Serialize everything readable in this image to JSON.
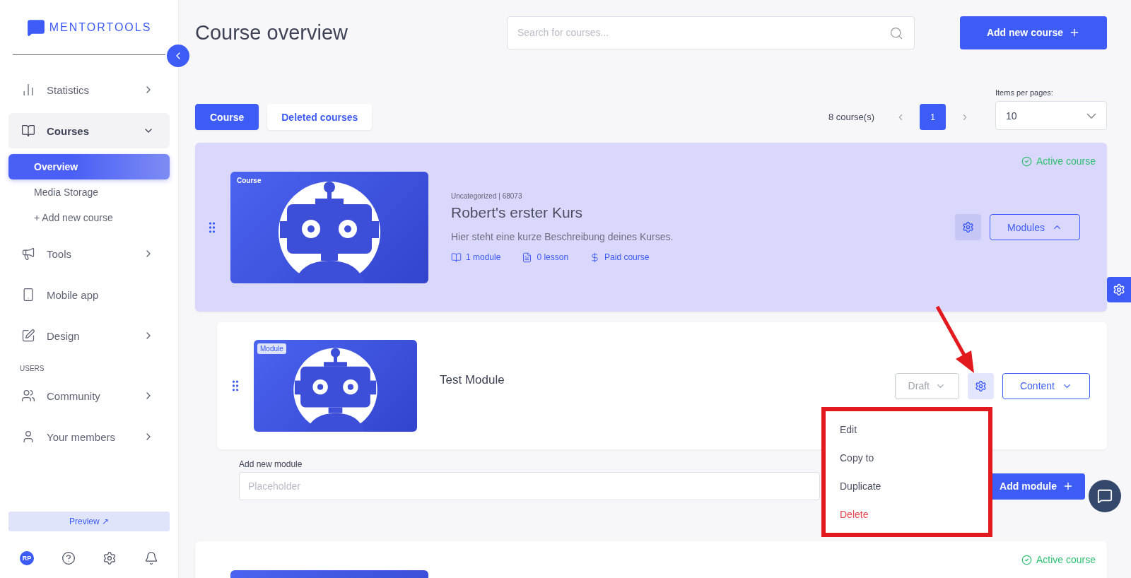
{
  "sidebar": {
    "logo": "MENTORTOOLS",
    "items": [
      {
        "kind": "item",
        "label": "Statistics",
        "expanded": false,
        "selected": false
      },
      {
        "kind": "item",
        "label": "Courses",
        "expanded": true,
        "selected": true,
        "children": [
          {
            "label": "Overview",
            "selected": true
          },
          {
            "label": "Media Storage",
            "selected": false
          },
          {
            "label": "+ Add new course",
            "selected": false
          }
        ]
      },
      {
        "kind": "item",
        "label": "Tools",
        "expanded": false,
        "selected": false
      },
      {
        "kind": "link",
        "label": "Mobile app",
        "selected": false
      },
      {
        "kind": "item",
        "label": "Design",
        "expanded": false,
        "selected": false
      },
      {
        "kind": "section",
        "label": "USERS"
      },
      {
        "kind": "item",
        "label": "Community",
        "expanded": false,
        "selected": false
      },
      {
        "kind": "item",
        "label": "Your members",
        "expanded": false,
        "selected": false
      }
    ],
    "preview": "Preview ↗",
    "avatar": "RP"
  },
  "header": {
    "title": "Course overview",
    "search": {
      "placeholder": "Search for courses..."
    },
    "add_button": "Add new course"
  },
  "tabs": [
    {
      "label": "Course",
      "selected": true
    },
    {
      "label": "Deleted courses",
      "selected": false
    }
  ],
  "pagination": {
    "count": "8 course(s)",
    "pages": [
      {
        "label": "1",
        "selected": true
      }
    ],
    "per_page_label": "Items per pages:",
    "per_page": "10"
  },
  "courses": [
    {
      "badge": "Course",
      "status": "Active course",
      "meta": "Uncategorized | 68073",
      "title": "Robert's erster Kurs",
      "description": "Hier steht eine kurze Beschreibung deines Kurses.",
      "stats": [
        {
          "text": "1 module"
        },
        {
          "text": "0 lesson"
        },
        {
          "text": "Paid course"
        }
      ],
      "modules_button": "Modules",
      "expanded": true,
      "modules": [
        {
          "badge": "Module",
          "title": "Test Module",
          "status": "Draft",
          "content_button": "Content",
          "menu": [
            {
              "label": "Edit",
              "kind": "normal"
            },
            {
              "label": "Copy to",
              "kind": "normal"
            },
            {
              "label": "Duplicate",
              "kind": "normal"
            },
            {
              "label": "Delete",
              "kind": "danger"
            }
          ]
        }
      ],
      "new_module": {
        "label": "Add new module",
        "placeholder": "Placeholder",
        "button": "Add module"
      }
    },
    {
      "status": "Active course",
      "expanded": false
    }
  ]
}
